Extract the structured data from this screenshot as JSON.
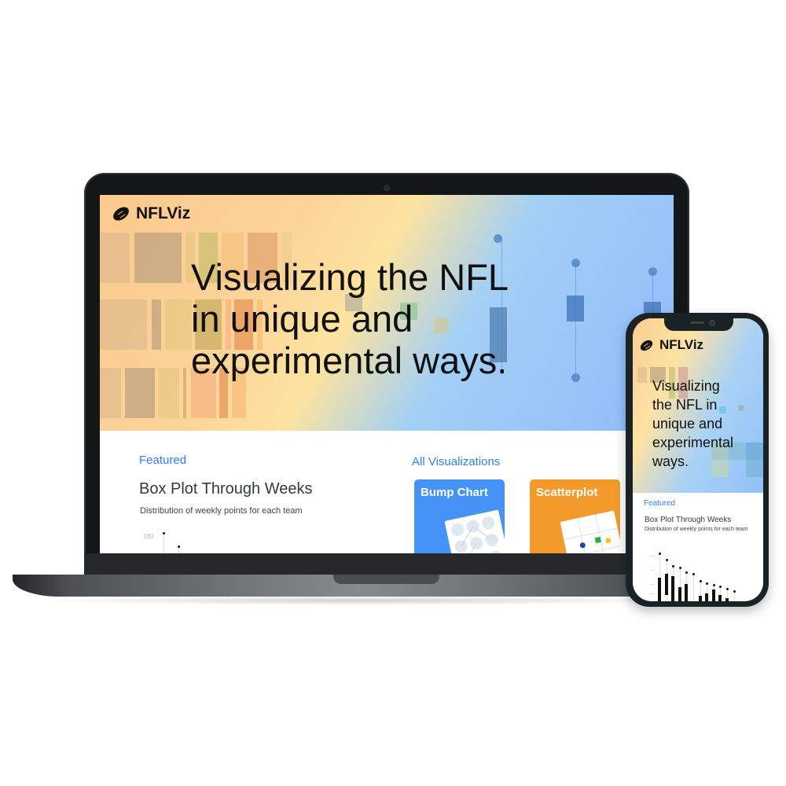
{
  "site": {
    "brand_name": "NFLViz",
    "logo_icon": "football-icon",
    "hero_title_lines": [
      "Visualizing the NFL",
      "in unique and",
      "experimental ways."
    ],
    "mobile_hero_title_lines": [
      "Visualizing",
      "the NFL in",
      "unique and",
      "experimental",
      "ways."
    ]
  },
  "featured": {
    "section_label": "Featured",
    "title": "Box Plot Through Weeks",
    "description": "Distribution of weekly points for each team",
    "y_tick_visible": "180"
  },
  "all_visualizations": {
    "section_label": "All Visualizations",
    "cards": [
      {
        "label": "Bump Chart",
        "color": "#4693f8"
      },
      {
        "label": "Scatterplot",
        "color": "#f39a2b"
      }
    ]
  },
  "colors": {
    "accent": "#2f80ed",
    "laptop_bezel": "#141718",
    "phone_frame": "#1b2226"
  }
}
